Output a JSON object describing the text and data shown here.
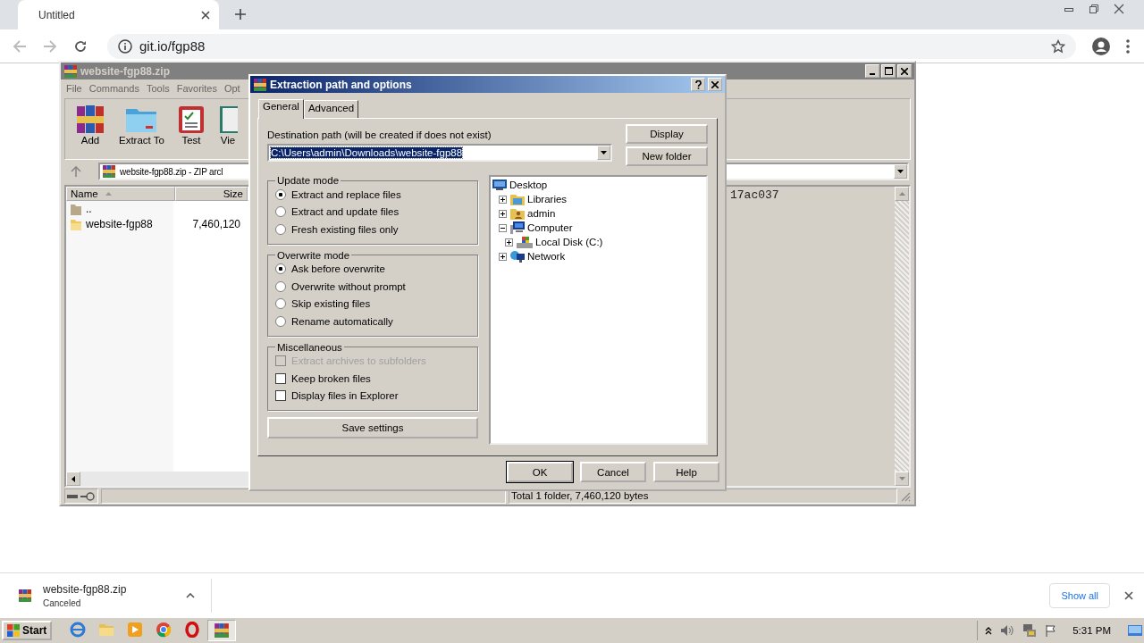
{
  "browser": {
    "tab": {
      "title": "Untitled"
    },
    "url": "git.io/fgp88"
  },
  "winrar": {
    "title": "website-fgp88.zip",
    "menu": [
      "File",
      "Commands",
      "Tools",
      "Favorites",
      "Opt"
    ],
    "toolbar": [
      {
        "label": "Add",
        "kind": "add"
      },
      {
        "label": "Extract To",
        "kind": "extract"
      },
      {
        "label": "Test",
        "kind": "test"
      },
      {
        "label": "Vie",
        "kind": "view"
      }
    ],
    "address": "website-fgp88.zip - ZIP arcl",
    "columns": [
      "Name",
      "Size"
    ],
    "files": [
      {
        "name": "..",
        "kind": "up"
      },
      {
        "name": "website-fgp88",
        "size": "7,460,120",
        "kind": "folder"
      }
    ],
    "comment": "17ac037",
    "status": "Total 1 folder, 7,460,120 bytes"
  },
  "dialog": {
    "title": "Extraction path and options",
    "tabs": [
      {
        "label": "General",
        "selected": true
      },
      {
        "label": "Advanced",
        "selected": false
      }
    ],
    "destination_label": "Destination path (will be created if does not exist)",
    "destination_path": "C:\\Users\\admin\\Downloads\\website-fgp88",
    "side_buttons": [
      "Display",
      "New folder"
    ],
    "update_mode": {
      "title": "Update mode",
      "options": [
        {
          "label": "Extract and replace files",
          "selected": true
        },
        {
          "label": "Extract and update files",
          "selected": false
        },
        {
          "label": "Fresh existing files only",
          "selected": false
        }
      ]
    },
    "overwrite_mode": {
      "title": "Overwrite mode",
      "options": [
        {
          "label": "Ask before overwrite",
          "selected": true
        },
        {
          "label": "Overwrite without prompt",
          "selected": false
        },
        {
          "label": "Skip existing files",
          "selected": false
        },
        {
          "label": "Rename automatically",
          "selected": false
        }
      ]
    },
    "miscellaneous": {
      "title": "Miscellaneous",
      "options": [
        {
          "label": "Extract archives to subfolders",
          "checked": false,
          "disabled": true
        },
        {
          "label": "Keep broken files",
          "checked": false,
          "disabled": false
        },
        {
          "label": "Display files in Explorer",
          "checked": false,
          "disabled": false
        }
      ]
    },
    "save_button": "Save settings",
    "tree": [
      {
        "label": "Desktop",
        "kind": "desktop",
        "children": [
          {
            "label": "Libraries",
            "kind": "libraries",
            "expanded": false
          },
          {
            "label": "admin",
            "kind": "user",
            "expanded": false
          },
          {
            "label": "Computer",
            "kind": "computer",
            "expanded": true,
            "children": [
              {
                "label": "Local Disk (C:)",
                "kind": "disk",
                "expanded": false
              }
            ]
          },
          {
            "label": "Network",
            "kind": "network",
            "expanded": false
          }
        ]
      }
    ],
    "buttons": [
      {
        "label": "OK",
        "default": true
      },
      {
        "label": "Cancel",
        "default": false
      },
      {
        "label": "Help",
        "default": false
      }
    ]
  },
  "downloads": {
    "file": "website-fgp88.zip",
    "status": "Canceled",
    "show_all": "Show all"
  },
  "taskbar": {
    "start": "Start",
    "apps": [
      {
        "kind": "ie",
        "selected": false
      },
      {
        "kind": "folder",
        "selected": false
      },
      {
        "kind": "media",
        "selected": false
      },
      {
        "kind": "chrome",
        "selected": false
      },
      {
        "kind": "opera",
        "selected": false
      },
      {
        "kind": "winrar",
        "selected": true
      }
    ],
    "clock": "5:31 PM"
  }
}
